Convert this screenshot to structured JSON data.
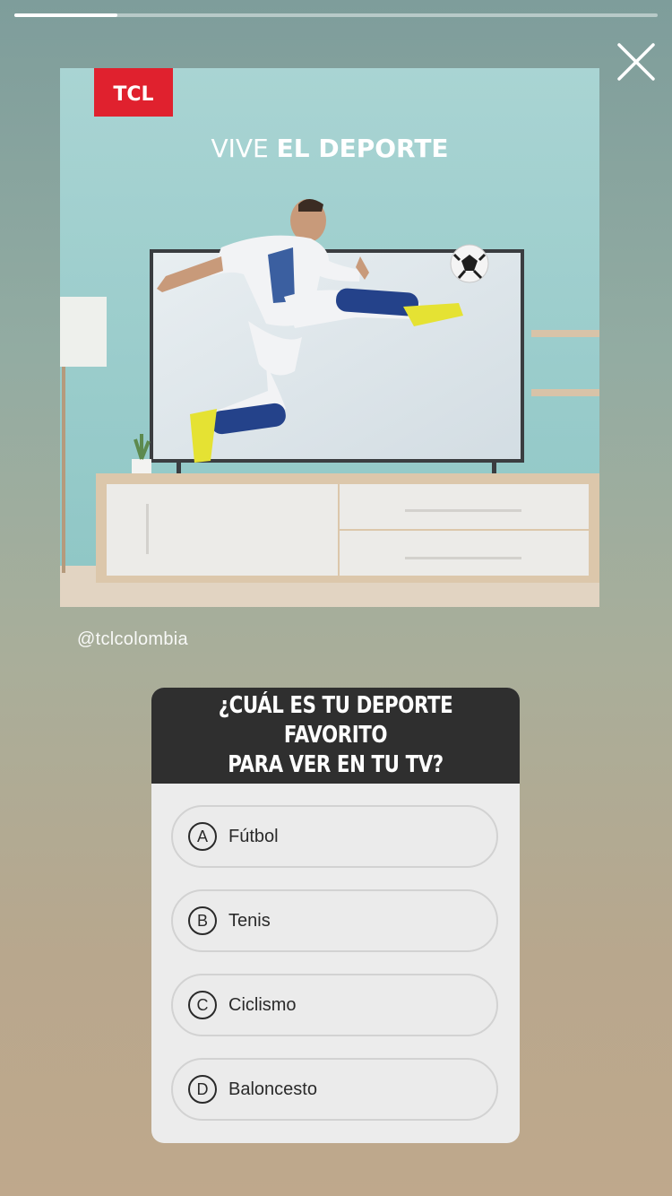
{
  "story": {
    "progress": 0.16,
    "close_icon": "close-icon",
    "username": "@tclcolombia"
  },
  "post": {
    "brand_logo": "TCL",
    "headline_light": "VIVE ",
    "headline_bold": "EL DEPORTE"
  },
  "quiz": {
    "question": "¿CUÁL ES TU DEPORTE FAVORITO\nPARA VER EN TU TV?",
    "options": [
      {
        "letter": "A",
        "label": "Fútbol"
      },
      {
        "letter": "B",
        "label": "Tenis"
      },
      {
        "letter": "C",
        "label": "Ciclismo"
      },
      {
        "letter": "D",
        "label": "Baloncesto"
      }
    ]
  },
  "colors": {
    "brand_red": "#e0212e",
    "quiz_header": "#2f2f2f",
    "quiz_body": "#ececec"
  }
}
